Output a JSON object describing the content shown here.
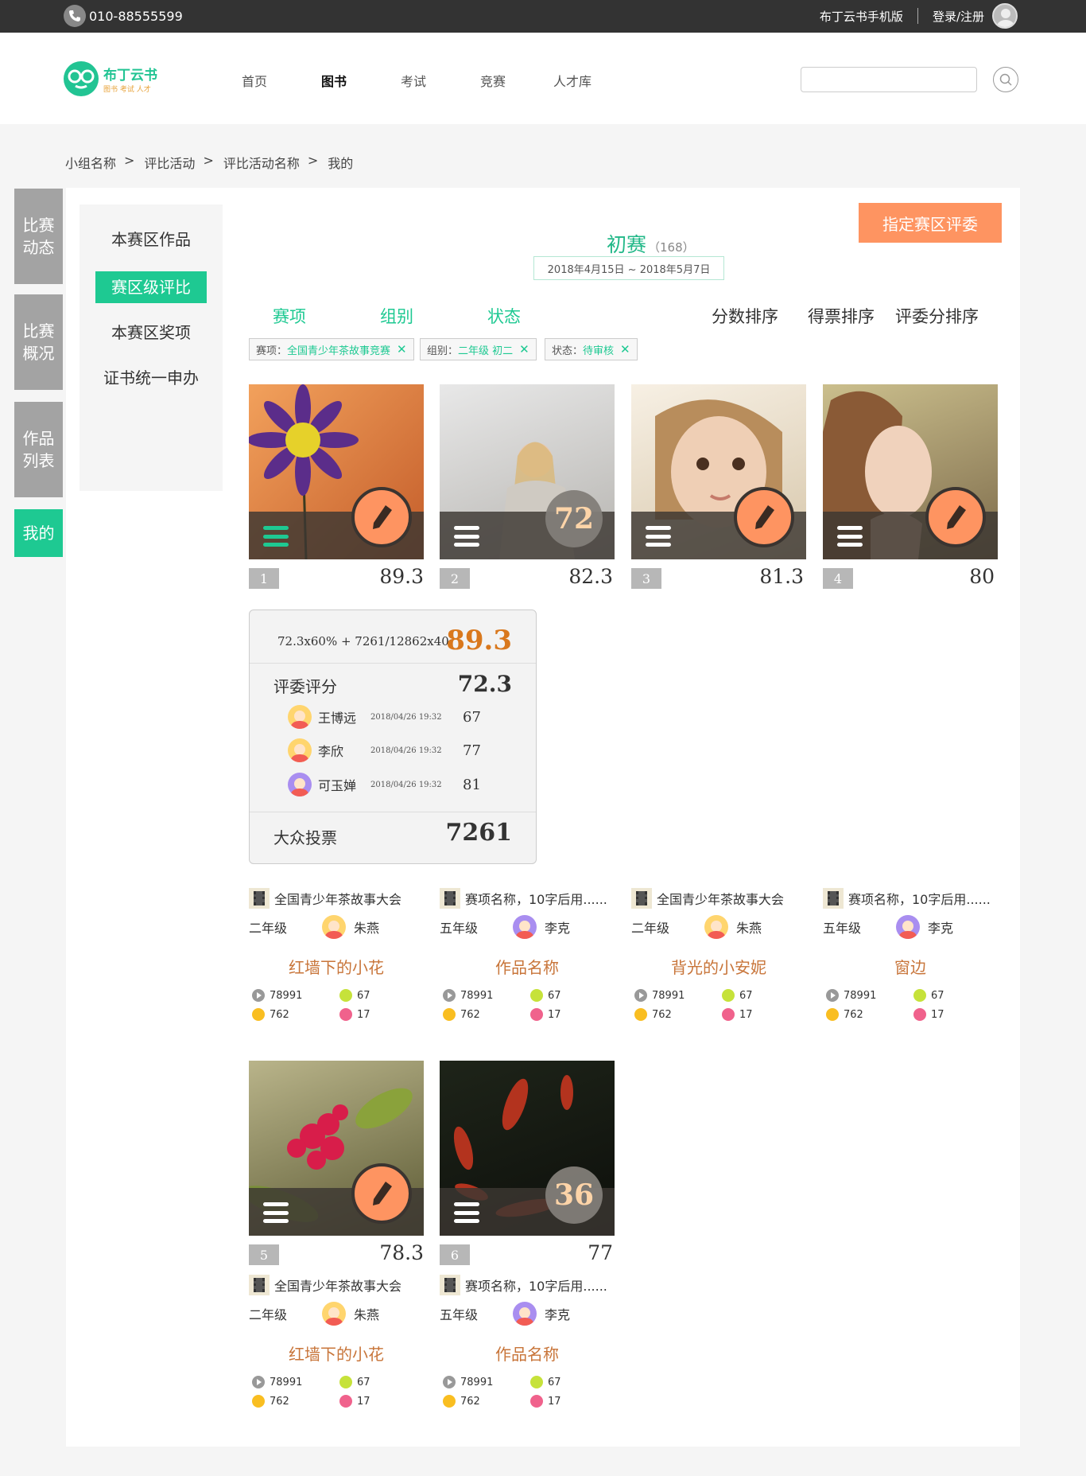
{
  "topbar": {
    "phone": "010-88555599",
    "mobile_version": "布丁云书手机版",
    "login": "登录/注册"
  },
  "header": {
    "logo_name": "布丁云书",
    "logo_sub": "图书 考试 人才",
    "nav": [
      "首页",
      "图书",
      "考试",
      "竞赛",
      "人才库"
    ],
    "search_placeholder": ""
  },
  "breadcrumb": [
    "小组名称",
    "评比活动",
    "评比活动名称",
    "我的"
  ],
  "side_tabs": [
    "比赛动态",
    "比赛概况",
    "作品列表",
    "我的"
  ],
  "subnav": [
    "本赛区作品",
    "赛区级评比",
    "本赛区奖项",
    "证书统一申办"
  ],
  "main": {
    "assign_button": "指定赛区评委",
    "round_title": "初赛",
    "round_count": "（168）",
    "round_dates": "2018年4月15日 ~ 2018年5月7日",
    "filters": [
      "赛项",
      "组别",
      "状态"
    ],
    "sorts": [
      "分数排序",
      "得票排序",
      "评委分排序"
    ],
    "chips": [
      {
        "label": "赛项：",
        "value": "全国青少年茶故事竞赛"
      },
      {
        "label": "组别：",
        "value": "二年级  初二"
      },
      {
        "label": "状态：",
        "value": "待审核"
      }
    ]
  },
  "works": [
    {
      "rank": "1",
      "total": "89.3",
      "judge": "",
      "contest": "全国青少年茶故事大会",
      "grade": "二年级",
      "author": "朱燕",
      "title": "红墙下的小花",
      "plays": "78991",
      "reviews": "67",
      "votes": "762",
      "judges": "17"
    },
    {
      "rank": "2",
      "total": "82.3",
      "judge": "72",
      "contest": "赛项名称，10字后用......",
      "grade": "五年级",
      "author": "李克",
      "title": "作品名称",
      "plays": "78991",
      "reviews": "67",
      "votes": "762",
      "judges": "17"
    },
    {
      "rank": "3",
      "total": "81.3",
      "judge": "",
      "contest": "全国青少年茶故事大会",
      "grade": "二年级",
      "author": "朱燕",
      "title": "背光的小安妮",
      "plays": "78991",
      "reviews": "67",
      "votes": "762",
      "judges": "17"
    },
    {
      "rank": "4",
      "total": "80",
      "judge": "",
      "contest": "赛项名称，10字后用......",
      "grade": "五年级",
      "author": "李克",
      "title": "窗边",
      "plays": "78991",
      "reviews": "67",
      "votes": "762",
      "judges": "17"
    },
    {
      "rank": "5",
      "total": "78.3",
      "judge": "",
      "contest": "全国青少年茶故事大会",
      "grade": "二年级",
      "author": "朱燕",
      "title": "红墙下的小花",
      "plays": "78991",
      "reviews": "67",
      "votes": "762",
      "judges": "17"
    },
    {
      "rank": "6",
      "total": "77",
      "judge": "36",
      "contest": "赛项名称，10字后用......",
      "grade": "五年级",
      "author": "李克",
      "title": "作品名称",
      "plays": "78991",
      "reviews": "67",
      "votes": "762",
      "judges": "17"
    }
  ],
  "popup": {
    "formula": "72.3x60% + 7261/12862x40",
    "final": "89.3",
    "judge_label": "评委评分",
    "judge_score": "72.3",
    "judges": [
      {
        "name": "王博远",
        "time": "2018/04/26  19:32",
        "score": "67"
      },
      {
        "name": "李欣",
        "time": "2018/04/26  19:32",
        "score": "77"
      },
      {
        "name": "可玉婵",
        "time": "2018/04/26  19:32",
        "score": "81"
      }
    ],
    "vote_label": "大众投票",
    "vote_value": "7261"
  },
  "colors": {
    "accent": "#1ec992",
    "orange": "#fe9461",
    "title": "#c8753a"
  }
}
